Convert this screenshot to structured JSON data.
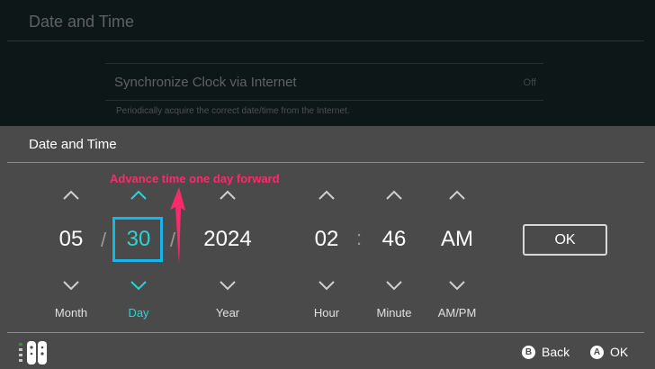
{
  "background": {
    "title": "Date and Time",
    "row_label": "Synchronize Clock via Internet",
    "row_value": "Off",
    "row_description": "Periodically acquire the correct date/time from the Internet."
  },
  "dialog": {
    "title": "Date and Time",
    "fields": [
      {
        "label": "Month",
        "value": "05"
      },
      {
        "label": "Day",
        "value": "30"
      },
      {
        "label": "Year",
        "value": "2024"
      },
      {
        "label": "Hour",
        "value": "02"
      },
      {
        "label": "Minute",
        "value": "46"
      },
      {
        "label": "AM/PM",
        "value": "AM"
      }
    ],
    "date_separator": "/",
    "time_separator": ":",
    "ok_label": "OK"
  },
  "annotation": {
    "text": "Advance time one day forward",
    "color": "#ff2a6d"
  },
  "footer": {
    "back_key": "B",
    "back_label": "Back",
    "ok_key": "A",
    "ok_label": "OK"
  },
  "colors": {
    "accent": "#27d6d6",
    "selection_border": "#17b6e8",
    "dialog_bg": "#4a4a4a"
  }
}
